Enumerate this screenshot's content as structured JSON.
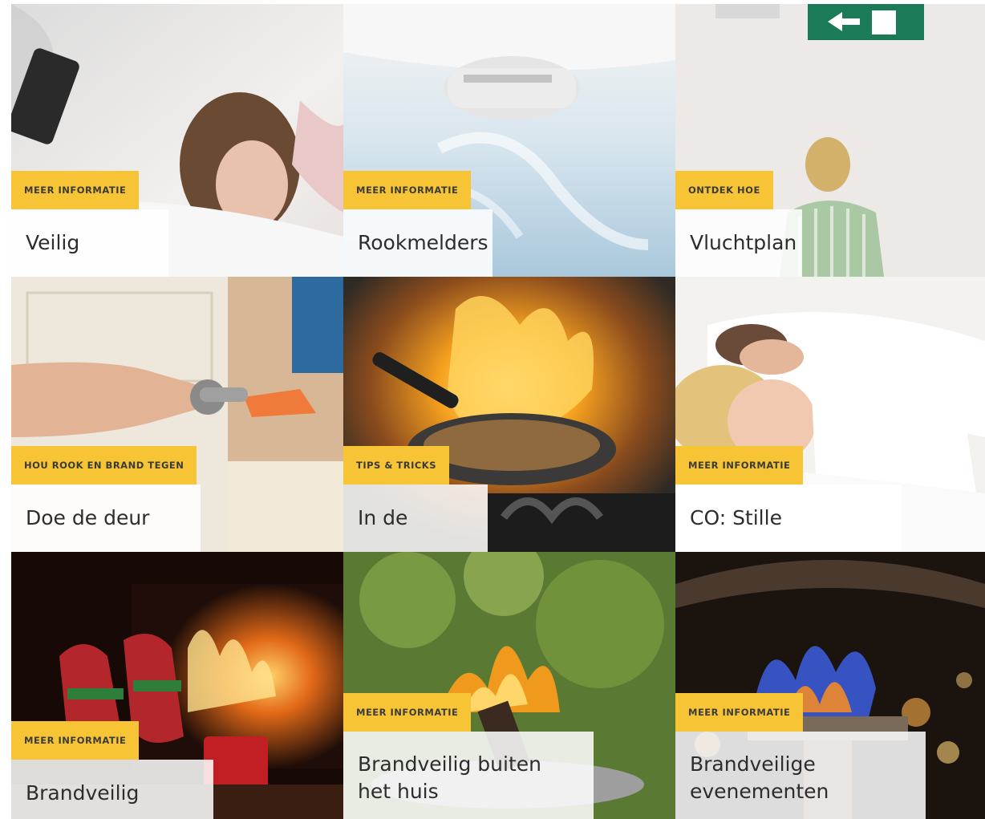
{
  "tiles": [
    {
      "badge": "MEER INFORMATIE",
      "title": "Veilig opladen",
      "image": "woman-sleeping-next-to-charging-phone"
    },
    {
      "badge": "MEER INFORMATIE",
      "title": "Rookmelders",
      "image": "smoke-detector-on-ceiling"
    },
    {
      "badge": "ONTDEK HOE",
      "title": "Vluchtplan",
      "image": "woman-below-exit-sign"
    },
    {
      "badge": "HOU ROOK EN BRAND TEGEN",
      "title": "Doe de deur dicht",
      "image": "hand-closing-door"
    },
    {
      "badge": "TIPS & TRICKS",
      "title": "In de keuken",
      "image": "frying-pan-on-fire"
    },
    {
      "badge": "MEER INFORMATIE",
      "title": "CO: Stille moordenaar",
      "image": "couple-sleeping-in-bed"
    },
    {
      "badge": "MEER INFORMATIE",
      "title": "Brandveilig feesten",
      "image": "socks-by-fireplace"
    },
    {
      "badge": "MEER INFORMATIE",
      "title": "Brandveilig buiten het huis",
      "image": "outdoor-fire-bowl"
    },
    {
      "badge": "MEER INFORMATIE",
      "title": "Brandveilige evenementen",
      "image": "gas-patio-heater-flame"
    }
  ]
}
